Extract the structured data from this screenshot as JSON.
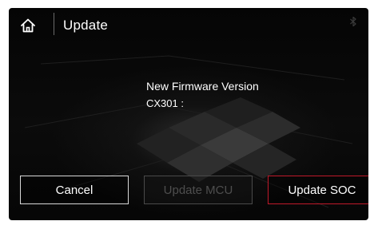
{
  "header": {
    "title": "Update",
    "home_icon": "home-icon",
    "bluetooth_icon": "bluetooth-icon"
  },
  "info": {
    "heading": "New Firmware Version",
    "model": "CX301 :"
  },
  "buttons": {
    "cancel": "Cancel",
    "update_mcu": "Update  MCU",
    "update_soc": "Update  SOC"
  },
  "colors": {
    "background": "#050505",
    "text": "#ffffff",
    "accent_red": "#c0192a",
    "disabled_text": "#4e4e4e"
  }
}
